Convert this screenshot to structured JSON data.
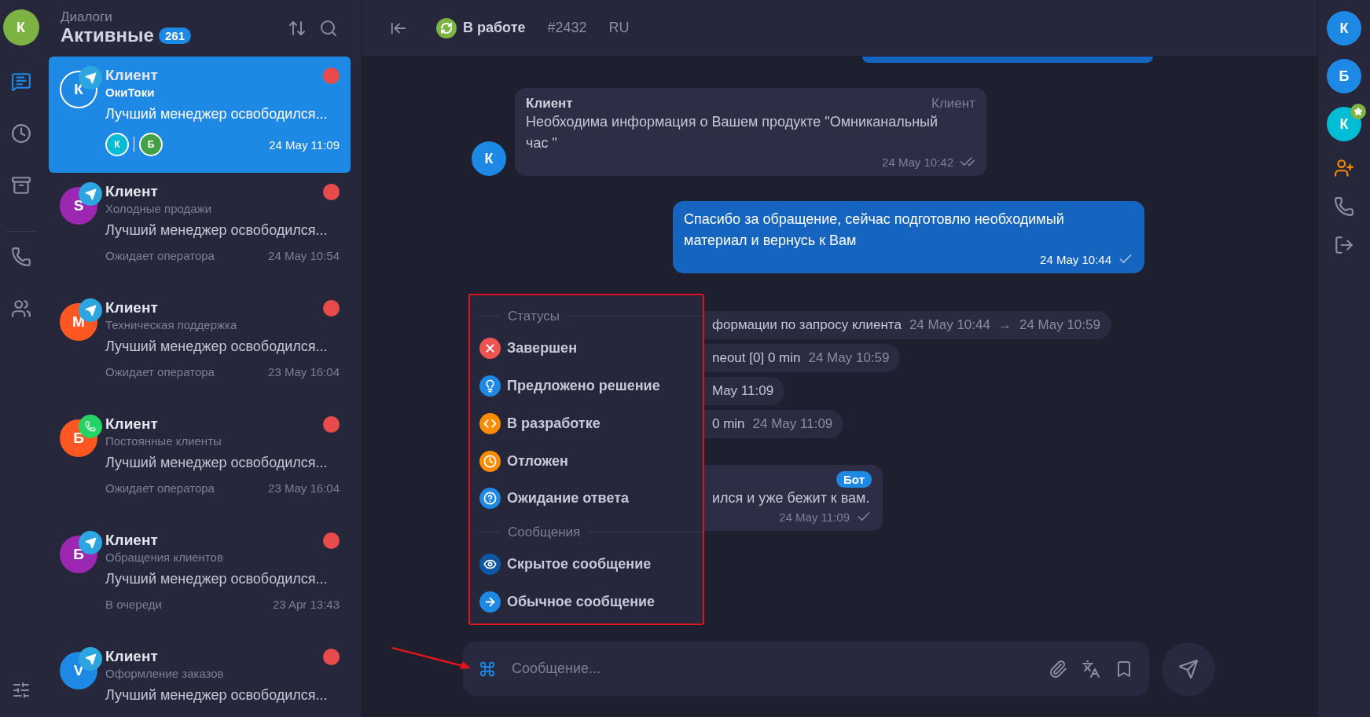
{
  "user_avatar": {
    "letter": "К",
    "color": "#7cb342"
  },
  "nav": [
    {
      "kind": "chats",
      "selected": true
    },
    {
      "kind": "history",
      "selected": false
    },
    {
      "kind": "archive",
      "selected": false
    },
    {
      "kind": "calls",
      "selected": false
    },
    {
      "kind": "contacts",
      "selected": false
    }
  ],
  "nav_bottom": {
    "kind": "filters"
  },
  "list_header": {
    "caption": "Диалоги",
    "title": "Активные",
    "count": "261"
  },
  "dialogs": [
    {
      "name": "Клиент",
      "channel": {
        "kind": "telegram"
      },
      "avatar": "К",
      "color": "#1e88e5",
      "subtitle": "ОкиТоки",
      "preview": "Лучший менеджер освободился...",
      "time": "24 May 11:09",
      "unread": true,
      "selected": true,
      "participants": [
        {
          "letter": "К",
          "color": "#00bcd4"
        },
        {
          "letter": "Б",
          "color": "#43a047"
        }
      ]
    },
    {
      "name": "Клиент",
      "channel": {
        "kind": "telegram"
      },
      "avatar": "S",
      "color": "#9c27b0",
      "subtitle": "Холодные продажи",
      "preview": "Лучший менеджер освободился...",
      "status": "Ожидает оператора",
      "time": "24 May 10:54",
      "unread": true,
      "selected": false
    },
    {
      "name": "Клиент",
      "channel": {
        "kind": "telegram"
      },
      "avatar": "М",
      "color": "#ff5722",
      "subtitle": "Техническая поддержка",
      "preview": "Лучший менеджер освободился...",
      "status": "Ожидает оператора",
      "time": "23 May 16:04",
      "unread": true,
      "selected": false
    },
    {
      "name": "Клиент",
      "channel": {
        "kind": "whatsapp"
      },
      "avatar": "Б",
      "color": "#ff5722",
      "subtitle": "Постоянные клиенты",
      "preview": "Лучший менеджер освободился...",
      "status": "Ожидает оператора",
      "time": "23 May 16:04",
      "unread": true,
      "selected": false
    },
    {
      "name": "Клиент",
      "channel": {
        "kind": "telegram"
      },
      "avatar": "Б",
      "color": "#9c27b0",
      "subtitle": "Обращения клиентов",
      "preview": "Лучший менеджер освободился...",
      "status": "В очереди",
      "time": "23 Apr 13:43",
      "unread": true,
      "selected": false
    },
    {
      "name": "Клиент",
      "channel": {
        "kind": "telegram"
      },
      "avatar": "V",
      "color": "#1e88e5",
      "subtitle": "Оформление заказов",
      "preview": "Лучший менеджер освободился...",
      "unread": true,
      "selected": false
    }
  ],
  "chat_header": {
    "status": "В работе",
    "ticket": "#2432",
    "language": "RU"
  },
  "messages": [
    {
      "kind": "cut_outgoing"
    },
    {
      "kind": "incoming",
      "avatar": "К",
      "author": "Клиент",
      "role": "Клиент",
      "text": "Необходима информация о Вашем продукте \"Омниканальный час \"",
      "time": "24 May 10:42",
      "read": true
    },
    {
      "kind": "outgoing",
      "text": "Спасибо за обращение, сейчас подготовлю необходимый материал и вернусь к Вам",
      "time": "24 May 10:44",
      "read": false
    },
    {
      "kind": "system",
      "parts": [
        "формации по запросу клиента",
        "24 May 10:44",
        "→",
        "24 May 10:59"
      ]
    },
    {
      "kind": "system",
      "parts": [
        "neout [0] 0 min",
        "24 May 10:59"
      ]
    },
    {
      "kind": "system",
      "parts": [
        "May 11:09"
      ]
    },
    {
      "kind": "system",
      "parts": [
        "0 min",
        "24 May 11:09"
      ]
    },
    {
      "kind": "bot",
      "badge": "Бот",
      "text": "ился и уже бежит к вам.",
      "time": "24 May 11:09",
      "read": false
    }
  ],
  "menu": {
    "sections": [
      {
        "title": "Статусы",
        "items": [
          {
            "label": "Завершен",
            "kind": "closed",
            "color": "#ef5350"
          },
          {
            "label": "Предложено решение",
            "kind": "solution",
            "color": "#1e88e5"
          },
          {
            "label": "В разработке",
            "kind": "development",
            "color": "#fb8c00"
          },
          {
            "label": "Отложен",
            "kind": "postponed",
            "color": "#fb8c00"
          },
          {
            "label": "Ожидание ответа",
            "kind": "waiting",
            "color": "#1e88e5"
          }
        ]
      },
      {
        "title": "Сообщения",
        "items": [
          {
            "label": "Скрытое сообщение",
            "kind": "hidden",
            "color": "#0d57a5"
          },
          {
            "label": "Обычное сообщение",
            "kind": "regular",
            "color": "#1e88e5"
          }
        ]
      }
    ]
  },
  "composer": {
    "placeholder": "Сообщение..."
  },
  "members": [
    {
      "letter": "К",
      "color": "#1e88e5",
      "starred": false
    },
    {
      "letter": "Б",
      "color": "#1e88e5",
      "starred": false
    },
    {
      "letter": "К",
      "color": "#00bcd4",
      "starred": true
    }
  ],
  "member_actions": [
    {
      "kind": "add_member"
    },
    {
      "kind": "call"
    },
    {
      "kind": "leave"
    }
  ]
}
